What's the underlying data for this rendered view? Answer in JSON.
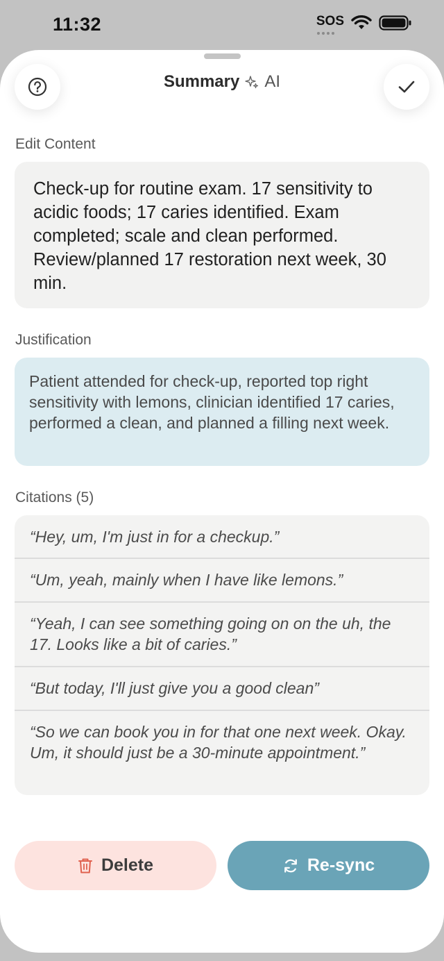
{
  "status_bar": {
    "time": "11:32",
    "sos": "SOS",
    "icons": [
      "wifi-icon",
      "battery-icon"
    ]
  },
  "header": {
    "title": "Summary",
    "ai_label": "AI",
    "help_icon": "question-circle-icon",
    "sparkle_icon": "sparkle-icon",
    "done_icon": "checkmark-icon"
  },
  "edit_content": {
    "label": "Edit Content",
    "text": "Check-up for routine exam. 17 sensitivity to acidic foods; 17 caries identified. Exam completed; scale and clean performed. Review/planned 17 restoration next week, 30 min."
  },
  "justification": {
    "label": "Justification",
    "text": "Patient attended for check-up, reported top right sensitivity with lemons, clinician identified 17 caries, performed a clean, and planned a filling next week."
  },
  "citations": {
    "label": "Citations (5)",
    "items": [
      "“Hey, um, I'm just in for a checkup.”",
      "“Um, yeah, mainly when I have like lemons.”",
      "“Yeah, I can see something going on on the uh, the 17. Looks like a bit of caries.”",
      "“But today, I'll just give you a good clean”",
      "“So we can book you in for that one next week. Okay. Um, it should just be a 30-minute appointment.”"
    ]
  },
  "actions": {
    "delete_label": "Delete",
    "resync_label": "Re-sync",
    "delete_icon": "trash-icon",
    "resync_icon": "refresh-icon"
  },
  "colors": {
    "justification_bg": "#dcecf1",
    "delete_bg": "#fde3df",
    "delete_icon": "#e0614f",
    "resync_bg": "#6aa4b7"
  }
}
